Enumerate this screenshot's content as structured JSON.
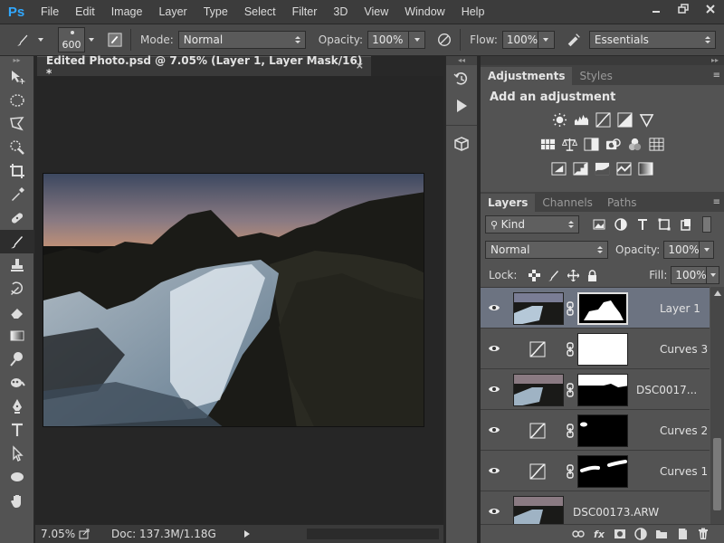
{
  "app": {
    "logo": "Ps"
  },
  "menu": [
    "File",
    "Edit",
    "Image",
    "Layer",
    "Type",
    "Select",
    "Filter",
    "3D",
    "View",
    "Window",
    "Help"
  ],
  "options": {
    "brush_size": "600",
    "mode_label": "Mode:",
    "mode_value": "Normal",
    "opacity_label": "Opacity:",
    "opacity_value": "100%",
    "flow_label": "Flow:",
    "flow_value": "100%",
    "workspace": "Essentials"
  },
  "document": {
    "tab_title": "Edited Photo.psd @ 7.05% (Layer 1, Layer Mask/16) *",
    "close_glyph": "×",
    "zoom": "7.05%",
    "doc_info": "Doc: 137.3M/1.18G"
  },
  "adjustments": {
    "tabs": [
      "Adjustments",
      "Styles"
    ],
    "title": "Add an adjustment"
  },
  "layers_panel": {
    "tabs": [
      "Layers",
      "Channels",
      "Paths"
    ],
    "filter_kind": "Kind",
    "blend_mode": "Normal",
    "opacity_label": "Opacity:",
    "opacity_value": "100%",
    "lock_label": "Lock:",
    "fill_label": "Fill:",
    "fill_value": "100%",
    "layers": [
      {
        "name": "Layer 1"
      },
      {
        "name": "Curves 3"
      },
      {
        "name": "DSC0017..."
      },
      {
        "name": "Curves 2"
      },
      {
        "name": "Curves 1"
      },
      {
        "name": "DSC00173.ARW"
      }
    ],
    "footer_fx": "fx"
  },
  "colors": {
    "ps_blue": "#31a8ff",
    "selected_layer": "#6c7381",
    "panel_bg": "#535353"
  }
}
